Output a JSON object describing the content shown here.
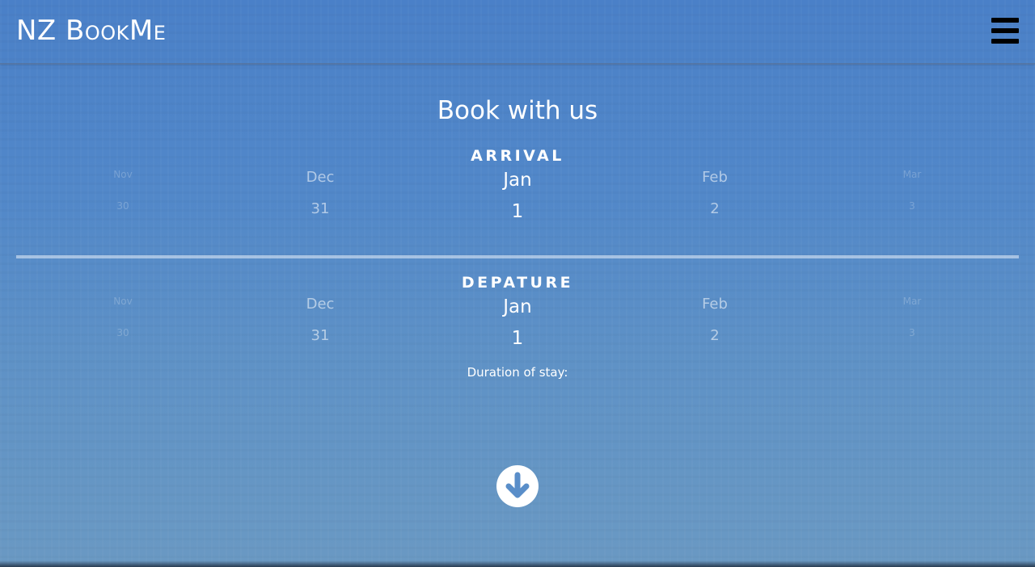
{
  "header": {
    "brand": "NZ BookMe",
    "menu_icon": "hamburger-menu-icon"
  },
  "main": {
    "title": "Book with us",
    "arrival": {
      "label": "ARRIVAL",
      "dates": [
        {
          "month": "Nov",
          "day": "30"
        },
        {
          "month": "Dec",
          "day": "31"
        },
        {
          "month": "Jan",
          "day": "1"
        },
        {
          "month": "Feb",
          "day": "2"
        },
        {
          "month": "Mar",
          "day": "3"
        }
      ],
      "selected_index": 2
    },
    "departure": {
      "label": "DEPATURE",
      "dates": [
        {
          "month": "Nov",
          "day": "30"
        },
        {
          "month": "Dec",
          "day": "31"
        },
        {
          "month": "Jan",
          "day": "1"
        },
        {
          "month": "Feb",
          "day": "2"
        },
        {
          "month": "Mar",
          "day": "3"
        }
      ],
      "selected_index": 2
    },
    "duration_label": "Duration of stay:",
    "scroll_icon": "arrow-circle-down-icon"
  },
  "colors": {
    "background_top": "#4a80c8",
    "background_bottom": "#6a99c3",
    "text": "#ffffff",
    "menu_icon": "#000000"
  }
}
